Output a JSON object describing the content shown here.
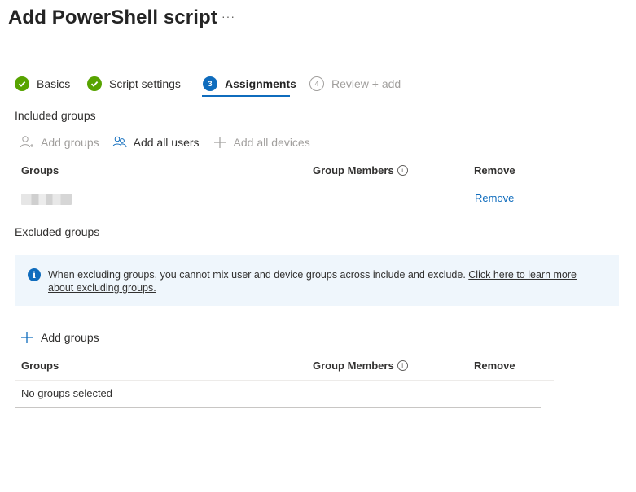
{
  "header": {
    "title": "Add PowerShell script",
    "more_label": "···"
  },
  "wizard": {
    "steps": [
      {
        "label": "Basics",
        "state": "done"
      },
      {
        "label": "Script settings",
        "state": "done"
      },
      {
        "label": "Assignments",
        "state": "current",
        "number": "3"
      },
      {
        "label": "Review + add",
        "state": "todo",
        "number": "4"
      }
    ]
  },
  "included": {
    "heading": "Included groups",
    "toolbar": {
      "add_groups": "Add groups",
      "add_all_users": "Add all users",
      "add_all_devices": "Add all devices"
    },
    "columns": {
      "groups": "Groups",
      "members": "Group Members",
      "remove": "Remove"
    },
    "rows": [
      {
        "group": "",
        "members": "",
        "remove": "Remove"
      }
    ]
  },
  "excluded": {
    "heading": "Excluded groups",
    "info": {
      "text": "When excluding groups, you cannot mix user and device groups across include and exclude. ",
      "link": "Click here to learn more about excluding groups."
    },
    "toolbar": {
      "add_groups": "Add groups"
    },
    "columns": {
      "groups": "Groups",
      "members": "Group Members",
      "remove": "Remove"
    },
    "empty": "No groups selected"
  },
  "colors": {
    "accent": "#0f6cbd",
    "success": "#57a300",
    "info_bg": "#eff6fc"
  }
}
